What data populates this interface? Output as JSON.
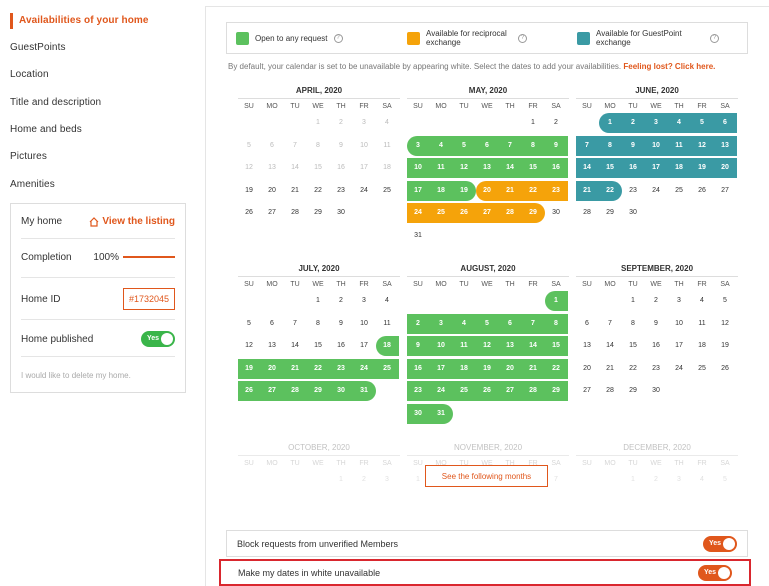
{
  "sidebar": {
    "items": [
      {
        "label": "Availabilities of your home",
        "active": true
      },
      {
        "label": "GuestPoints"
      },
      {
        "label": "Location"
      },
      {
        "label": "Title and description"
      },
      {
        "label": "Home and beds"
      },
      {
        "label": "Pictures"
      },
      {
        "label": "Amenities"
      }
    ],
    "card": {
      "my_home": "My home",
      "view_listing": "View the listing",
      "completion_label": "Completion",
      "completion_value": "100%",
      "home_id_label": "Home ID",
      "home_id_value": "#1732045",
      "published_label": "Home published",
      "published_toggle": "Yes",
      "delete_link": "I would like to delete my home."
    }
  },
  "legend": {
    "open": "Open to any request",
    "reciprocal": "Available for reciprocal exchange",
    "guestpoint": "Available for GuestPoint exchange",
    "colors": {
      "open": "#5cc15e",
      "reciprocal": "#f5a30a",
      "guestpoint": "#3a9aa4"
    }
  },
  "info": {
    "text": "By default, your calendar is set to be unavailable by appearing white. Select the dates to add your availabilities.",
    "lost": "Feeling lost? Click here."
  },
  "weekdays": [
    "SU",
    "MO",
    "TU",
    "WE",
    "TH",
    "FR",
    "SA"
  ],
  "months": [
    {
      "title": "APRIL, 2020",
      "start": 3,
      "days": 30,
      "past_until": 18,
      "bands": []
    },
    {
      "title": "MAY, 2020",
      "start": 5,
      "days": 31,
      "past_until": 0,
      "bands": [
        {
          "from": 3,
          "to": 9,
          "color": "open"
        },
        {
          "from": 10,
          "to": 16,
          "color": "open"
        },
        {
          "from": 17,
          "to": 19,
          "color": "open"
        },
        {
          "from": 20,
          "to": 23,
          "color": "reciprocal"
        },
        {
          "from": 24,
          "to": 29,
          "color": "reciprocal"
        }
      ]
    },
    {
      "title": "JUNE, 2020",
      "start": 1,
      "days": 30,
      "past_until": 0,
      "bands": [
        {
          "from": 1,
          "to": 6,
          "color": "guestpoint"
        },
        {
          "from": 7,
          "to": 13,
          "color": "guestpoint"
        },
        {
          "from": 14,
          "to": 20,
          "color": "guestpoint"
        },
        {
          "from": 21,
          "to": 22,
          "color": "guestpoint"
        }
      ]
    },
    {
      "title": "JULY, 2020",
      "start": 3,
      "days": 31,
      "past_until": 0,
      "bands": [
        {
          "from": 18,
          "to": 18,
          "color": "open"
        },
        {
          "from": 19,
          "to": 25,
          "color": "open"
        },
        {
          "from": 26,
          "to": 31,
          "color": "open"
        }
      ]
    },
    {
      "title": "AUGUST, 2020",
      "start": 6,
      "days": 31,
      "past_until": 0,
      "bands": [
        {
          "from": 1,
          "to": 1,
          "color": "open"
        },
        {
          "from": 2,
          "to": 8,
          "color": "open"
        },
        {
          "from": 9,
          "to": 15,
          "color": "open"
        },
        {
          "from": 16,
          "to": 22,
          "color": "open"
        },
        {
          "from": 23,
          "to": 29,
          "color": "open"
        },
        {
          "from": 30,
          "to": 31,
          "color": "open"
        }
      ]
    },
    {
      "title": "SEPTEMBER, 2020",
      "start": 2,
      "days": 30,
      "past_until": 0,
      "bands": []
    }
  ],
  "faded_months": [
    {
      "title": "OCTOBER, 2020",
      "start": 4
    },
    {
      "title": "NOVEMBER, 2020",
      "start": 0
    },
    {
      "title": "DECEMBER, 2020",
      "start": 2
    }
  ],
  "see_following": "See the following months",
  "options": {
    "block_label": "Block requests from unverified Members",
    "block_toggle": "Yes",
    "white_label": "Make my dates in white unavailable",
    "white_toggle": "Yes"
  }
}
